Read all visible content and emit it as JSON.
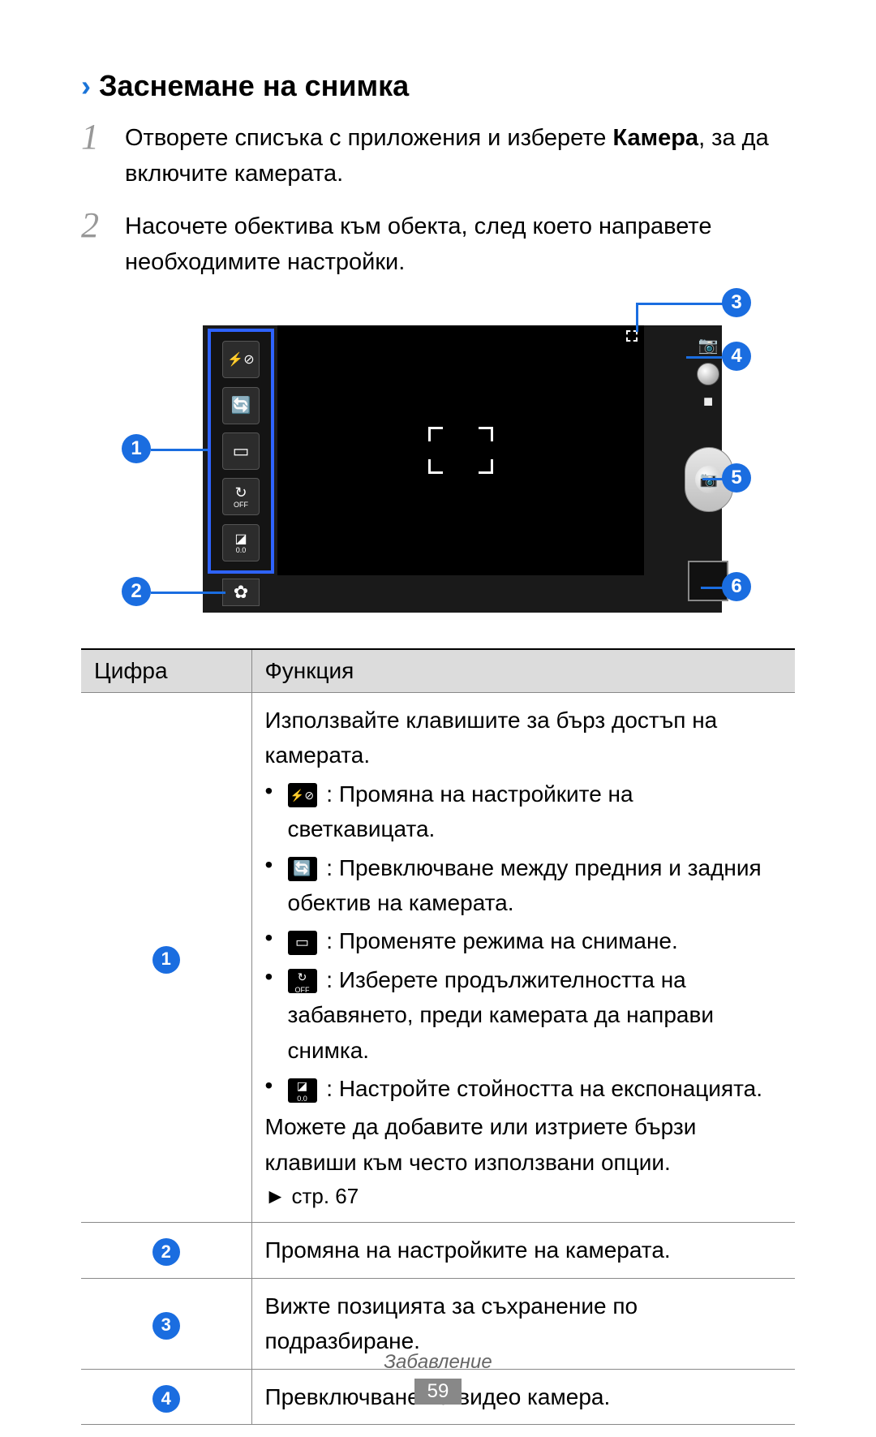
{
  "heading": "Заснемане на снимка",
  "steps": {
    "s1_pre": "Отворете списъка с приложения и изберете ",
    "s1_bold": "Камера",
    "s1_post": ", за да включите камерата.",
    "s2": "Насочете обектива към обекта, след което направете необходимите настройки."
  },
  "callouts": {
    "c1": "1",
    "c2": "2",
    "c3": "3",
    "c4": "4",
    "c5": "5",
    "c6": "6"
  },
  "shortcut_icons": {
    "flash": "⚡⊘",
    "switch_cam": "🔄",
    "mode": "▭",
    "timer": "↻",
    "timer_sub": "OFF",
    "exposure": "◪",
    "exposure_sub": "0.0"
  },
  "settings_icon": "✿",
  "mode_icons": {
    "photo": "📷",
    "video": "■"
  },
  "table": {
    "header_num": "Цифра",
    "header_func": "Функция",
    "row1": {
      "intro": "Използвайте клавишите за бърз достъп на камерата.",
      "b1": ": Промяна на настройките на светкавицата.",
      "b2": ": Превключване между предния и задния обектив на камерата.",
      "b3": ": Променяте режима на снимане.",
      "b4": ": Изберете продължителността на забавянето, преди камерата да направи снимка.",
      "b5": ": Настройте стойността на експонацията.",
      "outro": "Можете да добавите или изтриете бързи клавиши към често използвани опции.",
      "ref": "► стр. 67"
    },
    "row2": "Промяна на настройките на камерата.",
    "row3": "Вижте позицията за съхранение по подразбиране.",
    "row4": "Превключване на видео камера."
  },
  "footer_section": "Забавление",
  "page_number": "59"
}
